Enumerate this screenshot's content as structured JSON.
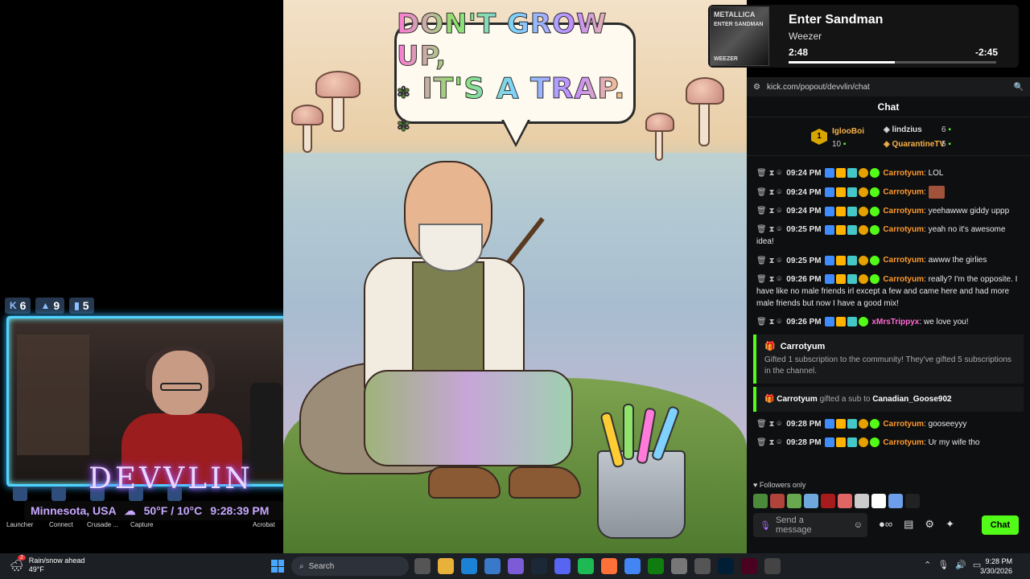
{
  "overlay": {
    "stats": [
      {
        "icon": "kick-icon",
        "value": "6"
      },
      {
        "icon": "followers-icon",
        "value": "9"
      },
      {
        "icon": "viewers-icon",
        "value": "5"
      }
    ],
    "brand": "DEVVLIN",
    "location": "Minnesota, USA",
    "weather": "50°F / 10°C",
    "time": "9:28:39 PM",
    "desktop_labels": [
      "Launcher",
      "Connect",
      "Crusade ...",
      "Capture",
      "Acrobat"
    ]
  },
  "artwork": {
    "line1": "DON'T GROW UP,",
    "line2": "IT'S A TRAP."
  },
  "now_playing": {
    "title": "Enter Sandman",
    "artist": "Weezer",
    "elapsed": "2:48",
    "remaining": "-2:45",
    "progress": 0.51,
    "cover_text_top": "METALLICA",
    "cover_text_mid": "ENTER SANDMAN",
    "cover_text_bottom": "WEEZER"
  },
  "chat": {
    "url": "kick.com/popout/devvlin/chat",
    "header": "Chat",
    "leaders": {
      "top": {
        "rank": "1",
        "name": "IglooBoi",
        "count": "10"
      },
      "second": {
        "name": "lindzius",
        "count": "6"
      },
      "third": {
        "name": "QuarantineTV",
        "count": "5"
      }
    },
    "messages": [
      {
        "time": "09:24 PM",
        "user": "Carrotyum",
        "text": "LOL",
        "emote": false
      },
      {
        "time": "09:24 PM",
        "user": "Carrotyum",
        "text": "",
        "emote": true
      },
      {
        "time": "09:24 PM",
        "user": "Carrotyum",
        "text": "yeehawww giddy uppp",
        "emote": false
      },
      {
        "time": "09:25 PM",
        "user": "Carrotyum",
        "text": "yeah no it's awesome idea!",
        "emote": false
      },
      {
        "time": "09:25 PM",
        "user": "Carrotyum",
        "text": "awww the girlies",
        "emote": false
      },
      {
        "time": "09:26 PM",
        "user": "Carrotyum",
        "text": "really? I'm the opposite. I have like no male friends irl except a few and came here and had more male friends but now I have a good mix!",
        "emote": false
      },
      {
        "time": "09:26 PM",
        "user": "xMrsTrippyx",
        "text": "we love you!",
        "emote": false
      }
    ],
    "gift1": {
      "name": "Carrotyum",
      "text": "Gifted 1 subscription to the community! They've gifted 5 subscriptions in the channel."
    },
    "gift2": {
      "name": "Carrotyum",
      "middle": "gifted a sub to",
      "recipient": "Canadian_Goose902"
    },
    "messages2": [
      {
        "time": "09:28 PM",
        "user": "Carrotyum",
        "text": "gooseeyyy"
      },
      {
        "time": "09:28 PM",
        "user": "Carrotyum",
        "text": "Ur my wife tho"
      }
    ],
    "followers_only": "Followers only",
    "send_placeholder": "Send a message",
    "chat_button": "Chat"
  },
  "taskbar": {
    "weather_title": "Rain/snow ahead",
    "weather_temp": "49°F",
    "weather_badge": "2",
    "search": "Search",
    "clock_time": "9:28 PM",
    "clock_date": "3/30/2026"
  }
}
